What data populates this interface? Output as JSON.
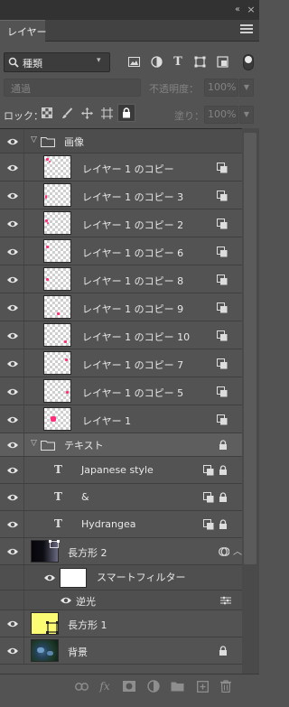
{
  "panel": {
    "tab_label": "レイヤー",
    "collapse_glyph": "‹‹",
    "close_glyph": "×"
  },
  "filter": {
    "kind_label": "種類"
  },
  "blend": {
    "mode_label": "通過",
    "opacity_label": "不透明度：",
    "opacity_value": "100%"
  },
  "lock": {
    "label": "ロック：",
    "fill_label": "塗り：",
    "fill_value": "100%"
  },
  "layers": {
    "group_images": "画像",
    "copy_0": "レイヤー 1 のコピー",
    "copy_3": "レイヤー 1 のコピー 3",
    "copy_2": "レイヤー 1 のコピー 2",
    "copy_6": "レイヤー 1 のコピー 6",
    "copy_8": "レイヤー 1 のコピー 8",
    "copy_9": "レイヤー 1 のコピー 9",
    "copy_10": "レイヤー 1 のコピー 10",
    "copy_7": "レイヤー 1 のコピー 7",
    "copy_5": "レイヤー 1 のコピー 5",
    "layer1": "レイヤー 1",
    "group_text": "テキスト",
    "text_japanese": "Japanese style",
    "text_amp": "&",
    "text_hydrangea": "Hydrangea",
    "rect2": "長方形 2",
    "smart_filter": "スマートフィルター",
    "backlight": "逆光",
    "rect1": "長方形 1",
    "background": "背景"
  },
  "glyphs": {
    "text_layer": "T",
    "fx": "fx",
    "chevron_down": "⌄",
    "chevron_right": "⌄"
  },
  "colors": {
    "panel_bg": "#535353",
    "selected_group": "#5e5e5e",
    "pink_flower": "#ff2d7a",
    "rect1_fill": "#fbfb74"
  },
  "icons": [
    "eye-icon",
    "folder-icon",
    "smart-object-icon",
    "lock-icon",
    "link-icon",
    "fx-icon",
    "mask-icon",
    "adjustment-icon",
    "new-group-icon",
    "new-layer-icon",
    "trash-icon"
  ]
}
